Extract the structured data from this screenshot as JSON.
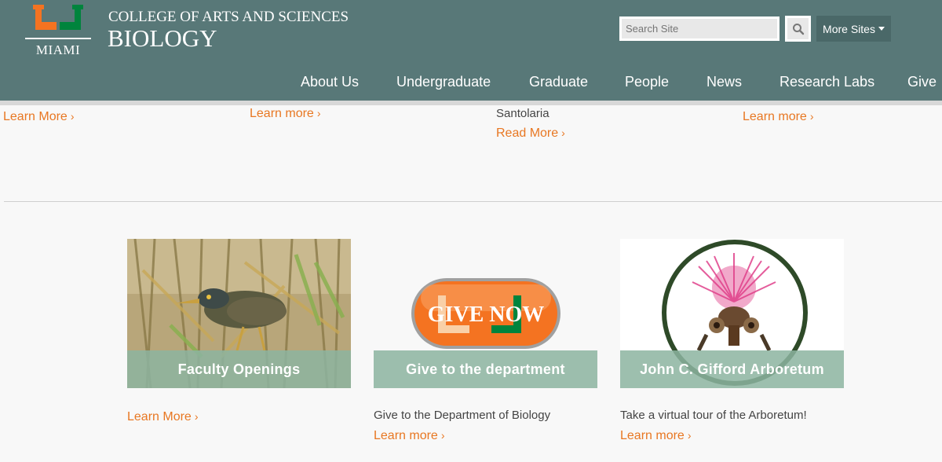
{
  "header": {
    "logo_text": "MIAMI",
    "college": "COLLEGE OF ARTS AND SCIENCES",
    "department": "BIOLOGY",
    "search_placeholder": "Search Site",
    "more_sites_label": "More Sites"
  },
  "nav": {
    "items": [
      "About Us",
      "Undergraduate",
      "Graduate",
      "People",
      "News",
      "Research Labs",
      "Give"
    ]
  },
  "top_row": {
    "link1": "Learn More",
    "link2": "Learn more",
    "name3": "Santolaria",
    "link3": "Read More",
    "link4": "Learn more"
  },
  "cards": [
    {
      "caption": "Faculty Openings",
      "description": "",
      "link": "Learn More"
    },
    {
      "caption": "Give to the department",
      "badge": "GIVE NOW",
      "description": "Give to the Department of Biology",
      "link": "Learn more"
    },
    {
      "caption": "John C. Gifford Arboretum",
      "description": "Take a virtual tour of the Arboretum!",
      "link": "Learn more"
    }
  ],
  "colors": {
    "header_bg": "#587878",
    "accent_orange": "#e87722",
    "brand_green": "#005030",
    "caption_green": "#8cb4a0"
  },
  "icons": {
    "search": "search-icon",
    "dropdown": "caret-down-icon",
    "chevron": "chevron-right-icon"
  }
}
